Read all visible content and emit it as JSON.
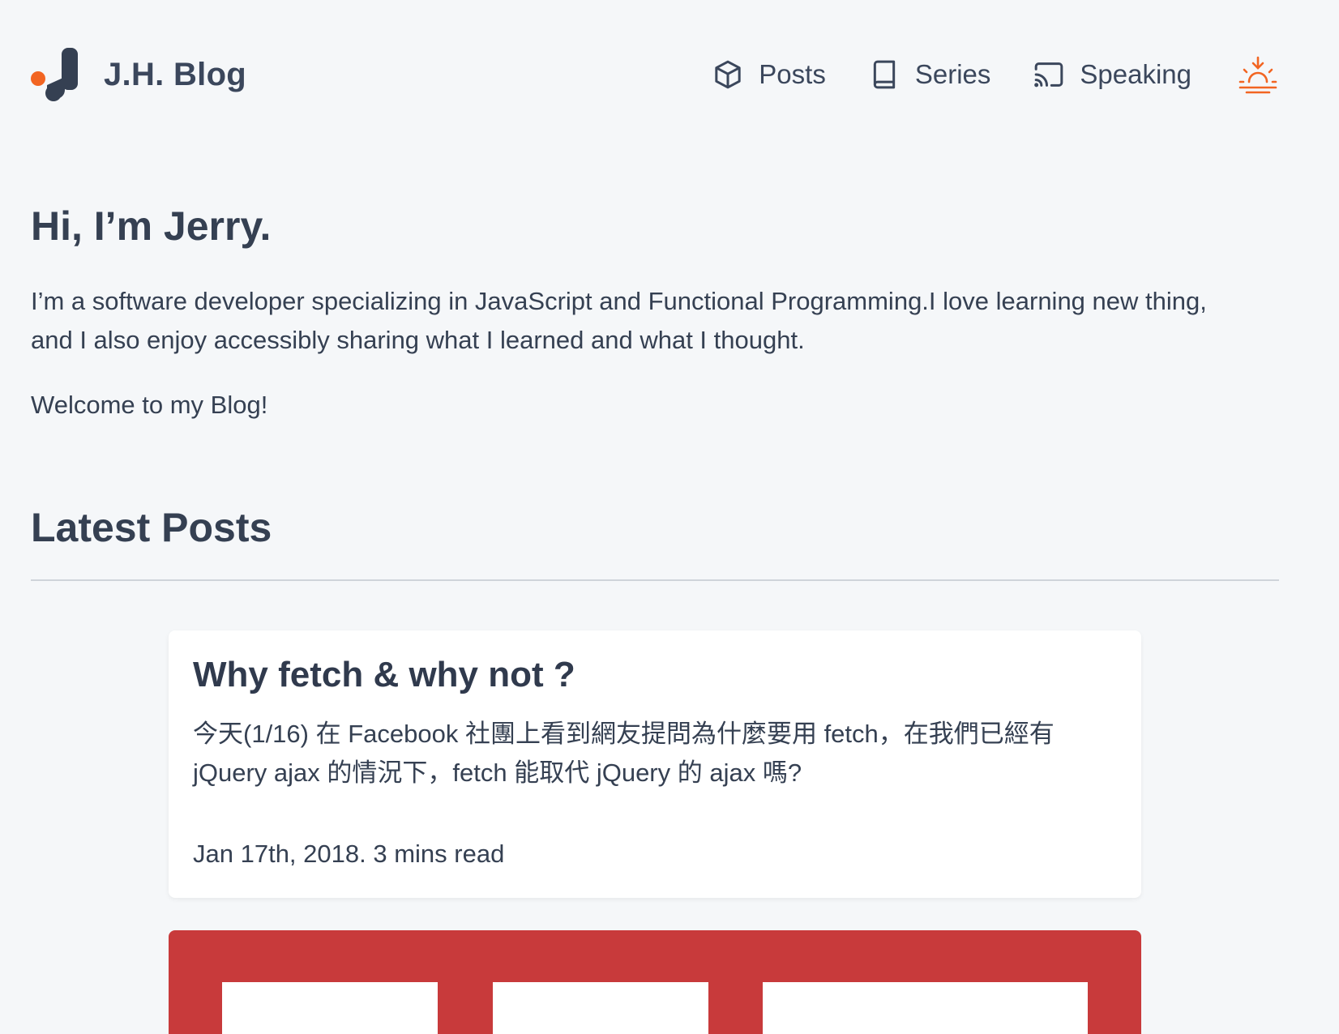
{
  "header": {
    "brand": "J.H. Blog",
    "nav": [
      {
        "label": "Posts",
        "icon": "cube-icon"
      },
      {
        "label": "Series",
        "icon": "book-icon"
      },
      {
        "label": "Speaking",
        "icon": "cast-icon"
      }
    ],
    "theme_toggle_icon": "sunrise-icon"
  },
  "intro": {
    "title": "Hi, I’m Jerry.",
    "bio": "I’m a software developer specializing in JavaScript and Functional Programming.I love learning new thing, and I also enjoy accessibly sharing what I learned and what I thought.",
    "welcome": "Welcome to my Blog!"
  },
  "latest": {
    "heading": "Latest Posts",
    "posts": [
      {
        "title": "Why fetch & why not ?",
        "excerpt": "今天(1/16) 在 Facebook 社團上看到網友提問為什麼要用 fetch，在我們已經有 jQuery ajax 的情況下，fetch 能取代 jQuery 的 ajax 嗎?",
        "meta": "Jan 17th, 2018. 3 mins read"
      }
    ]
  },
  "colors": {
    "background": "#f5f7f9",
    "text": "#354052",
    "accent": "#f26522",
    "card_image_red": "#c83a3b"
  }
}
